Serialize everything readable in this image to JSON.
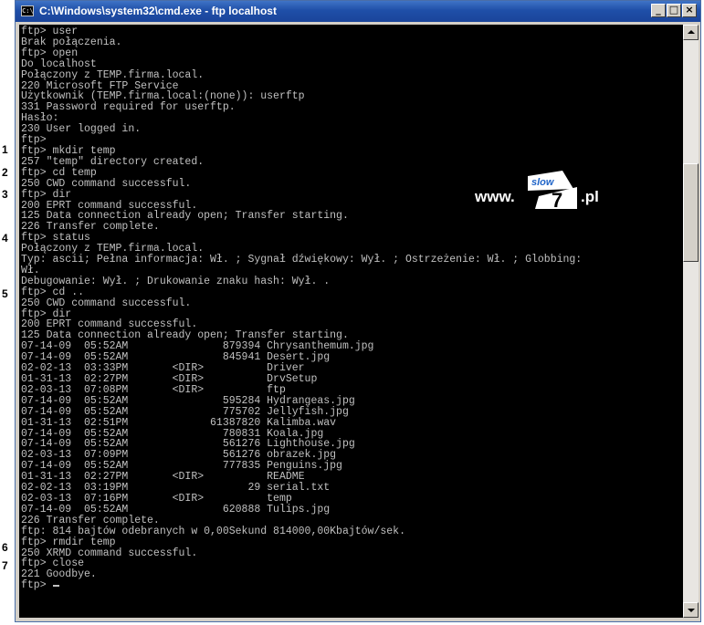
{
  "window": {
    "title": "C:\\Windows\\system32\\cmd.exe - ftp  localhost",
    "icon": "cmd-icon",
    "icon_text": "C:\\",
    "buttons": {
      "minimize": "_",
      "maximize": "□",
      "close": "×"
    }
  },
  "steps": [
    "1",
    "2",
    "3",
    "4",
    "5",
    "6",
    "7"
  ],
  "watermark": {
    "prefix": "www.",
    "logo_top": "slow",
    "logo_number": "7",
    "suffix": ".pl"
  },
  "console": {
    "lines": [
      "ftp> user",
      "Brak połączenia.",
      "ftp> open",
      "Do localhost",
      "Połączony z TEMP.firma.local.",
      "220 Microsoft FTP Service",
      "Użytkownik (TEMP.firma.local:(none)): userftp",
      "331 Password required for userftp.",
      "Hasło:",
      "230 User logged in.",
      "ftp>",
      "ftp> mkdir temp",
      "257 \"temp\" directory created.",
      "ftp> cd temp",
      "250 CWD command successful.",
      "ftp> dir",
      "200 EPRT command successful.",
      "125 Data connection already open; Transfer starting.",
      "226 Transfer complete.",
      "ftp> status",
      "Połączony z TEMP.firma.local.",
      "Typ: ascii; Pełna informacja: Wł. ; Sygnał dźwiękowy: Wył. ; Ostrzeżenie: Wł. ; Globbing:",
      "Wł.",
      "Debugowanie: Wył. ; Drukowanie znaku hash: Wył. .",
      "ftp> cd ..",
      "250 CWD command successful.",
      "ftp> dir",
      "200 EPRT command successful.",
      "125 Data connection already open; Transfer starting.",
      "07-14-09  05:52AM               879394 Chrysanthemum.jpg",
      "07-14-09  05:52AM               845941 Desert.jpg",
      "02-02-13  03:33PM       <DIR>          Driver",
      "01-31-13  02:27PM       <DIR>          DrvSetup",
      "02-03-13  07:08PM       <DIR>          ftp",
      "07-14-09  05:52AM               595284 Hydrangeas.jpg",
      "07-14-09  05:52AM               775702 Jellyfish.jpg",
      "01-31-13  02:51PM             61387820 Kalimba.wav",
      "07-14-09  05:52AM               780831 Koala.jpg",
      "07-14-09  05:52AM               561276 Lighthouse.jpg",
      "02-03-13  07:09PM               561276 obrazek.jpg",
      "07-14-09  05:52AM               777835 Penguins.jpg",
      "01-31-13  02:27PM       <DIR>          README",
      "02-02-13  03:19PM                   29 serial.txt",
      "02-03-13  07:16PM       <DIR>          temp",
      "07-14-09  05:52AM               620888 Tulips.jpg",
      "226 Transfer complete.",
      "ftp: 814 bajtów odebranych w 0,00Sekund 814000,00Kbajtów/sek.",
      "ftp> rmdir temp",
      "250 XRMD command successful.",
      "ftp> close",
      "221 Goodbye.",
      "ftp> "
    ]
  }
}
